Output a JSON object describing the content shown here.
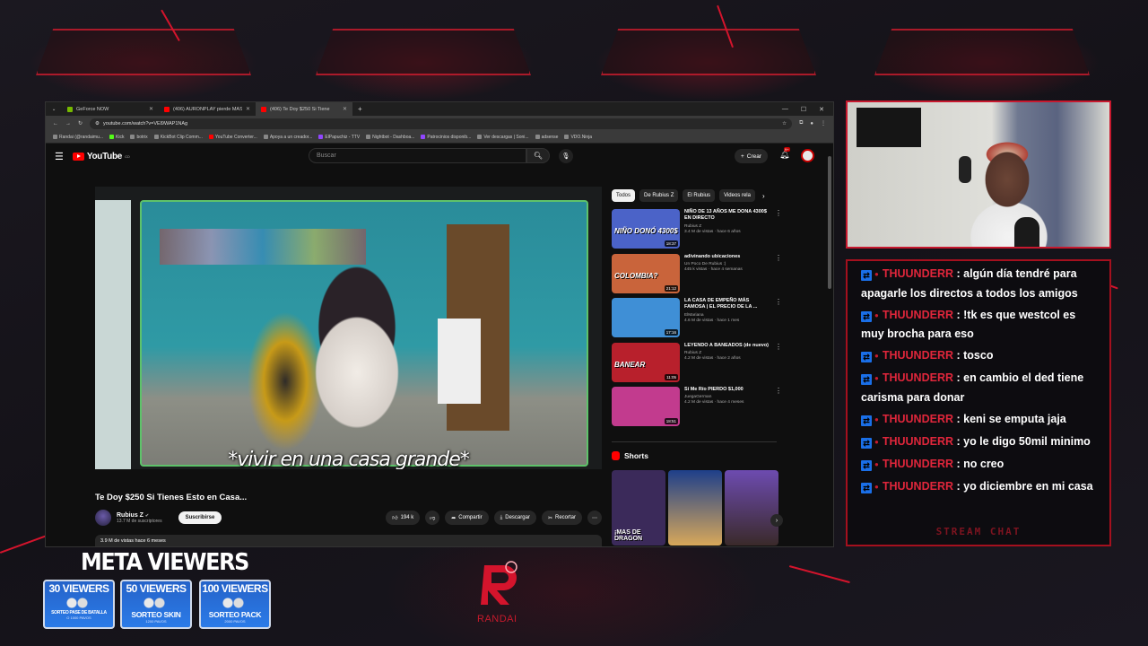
{
  "browser": {
    "tabs": [
      {
        "label": "GeForce NOW",
        "color": "#76b900",
        "active": false
      },
      {
        "label": "(406) AURONPLAY pierde MAS",
        "color": "#ff0000",
        "active": false
      },
      {
        "label": "(406) Te Doy $250 Si Tiene",
        "color": "#ff0000",
        "active": true
      }
    ],
    "url": "youtube.com/watch?v=VEl9WAP1NAg",
    "bookmarks": [
      "Randai (@randaimu...",
      "Kick",
      "botrix",
      "KickBot Clip Comm...",
      "YouTube Converter...",
      "Apoya a un creador...",
      "ElPapuchiz - TTV",
      "Nightbot - Dashboa...",
      "Patrocinios disponib...",
      "Ver descargas | Soni...",
      "adsense",
      "VDO.Ninja"
    ]
  },
  "youtube": {
    "logo_text": "YouTube",
    "logo_region": "CO",
    "search_placeholder": "Buscar",
    "create_label": "Crear",
    "notif_count": "9+",
    "caption": "*vivir en una casa grande*",
    "video_title": "Te Doy $250 Si Tienes Esto en Casa...",
    "channel_name": "Rubius Z",
    "channel_subs": "13.7 M de suscriptores",
    "subscribe_label": "Suscribirse",
    "likes": "194 k",
    "share_label": "Compartir",
    "download_label": "Descargar",
    "clip_label": "Recortar",
    "views_meta": "3.9 M de vistas  hace 6 meses",
    "chips": [
      "Todos",
      "De Rubius Z",
      "El Rubius",
      "Videos rela"
    ],
    "recommendations": [
      {
        "title": "NIÑO DE 13 AÑOS ME DONA 4300$ EN DIRECTO",
        "channel": "Rubius Z",
        "meta": "3.4 M de vistas · hace 6 años",
        "duration": "18:37",
        "thumb_text": "NIÑO DONÓ 4300$",
        "bg": "#4b63c8"
      },
      {
        "title": "adivinando ubicaciones",
        "channel": "Un Poco De Rubius :)",
        "meta": "445 k vistas · hace 4 semanas",
        "duration": "21:12",
        "thumb_text": "COLOMBIA?",
        "bg": "#c9643b"
      },
      {
        "title": "LA CASA DE EMPEÑO MÁS FAMOSA | EL PRECIO DE LA ...",
        "channel": "ElMariana",
        "meta": "4.6 M de vistas · hace 1 mes",
        "duration": "17:16",
        "thumb_text": "",
        "bg": "#3f8fd6"
      },
      {
        "title": "LEYENDO A BANEADOS (de nuevo)",
        "channel": "Rubius Z",
        "meta": "4.2 M de vistas · hace 2 años",
        "duration": "11:05",
        "thumb_text": "BANEAR",
        "bg": "#b8202c"
      },
      {
        "title": "Sí Me Río PIERDO $1,000",
        "channel": "JuegaGerman",
        "meta": "4.2 M de vistas · hace 4 meses",
        "duration": "18:51",
        "thumb_text": "",
        "bg": "#c23b8e"
      }
    ],
    "shorts_label": "Shorts",
    "shorts": [
      {
        "label": "¡MAS DE DRAGON",
        "bg": "#3b2a5a"
      },
      {
        "label": "",
        "bg": "#1e3f8a"
      },
      {
        "label": "",
        "bg": "#6d4bb0"
      }
    ]
  },
  "chat": {
    "messages": [
      {
        "user": "THUUNDERR",
        "text": "algún día tendré para apagarle los directos a todos los amigos"
      },
      {
        "user": "THUUNDERR",
        "text": "!tk es que westcol es muy brocha para eso"
      },
      {
        "user": "THUUNDERR",
        "text": "tosco"
      },
      {
        "user": "THUUNDERR",
        "text": "en cambio el ded tiene carisma para donar"
      },
      {
        "user": "THUUNDERR",
        "text": "keni se emputa jaja"
      },
      {
        "user": "THUUNDERR",
        "text": "yo le digo 50mil minimo"
      },
      {
        "user": "THUUNDERR",
        "text": "no creo"
      },
      {
        "user": "THUUNDERR",
        "text": "yo diciembre en mi casa"
      }
    ],
    "footer": "STREAM CHAT"
  },
  "meta": {
    "title": "META VIEWERS",
    "goals": [
      {
        "count": "30 VIEWERS",
        "reward": "SORTEO PASE DE BATALLA",
        "cost": "O 1000 PAVOS"
      },
      {
        "count": "50 VIEWERS",
        "reward": "SORTEO SKIN",
        "cost": "1200 PAVOS"
      },
      {
        "count": "100 VIEWERS",
        "reward": "SORTEO PACK",
        "cost": "2000 PAVOS"
      }
    ]
  },
  "brand": {
    "name": "RANDAI",
    "accent": "#d4142c"
  }
}
